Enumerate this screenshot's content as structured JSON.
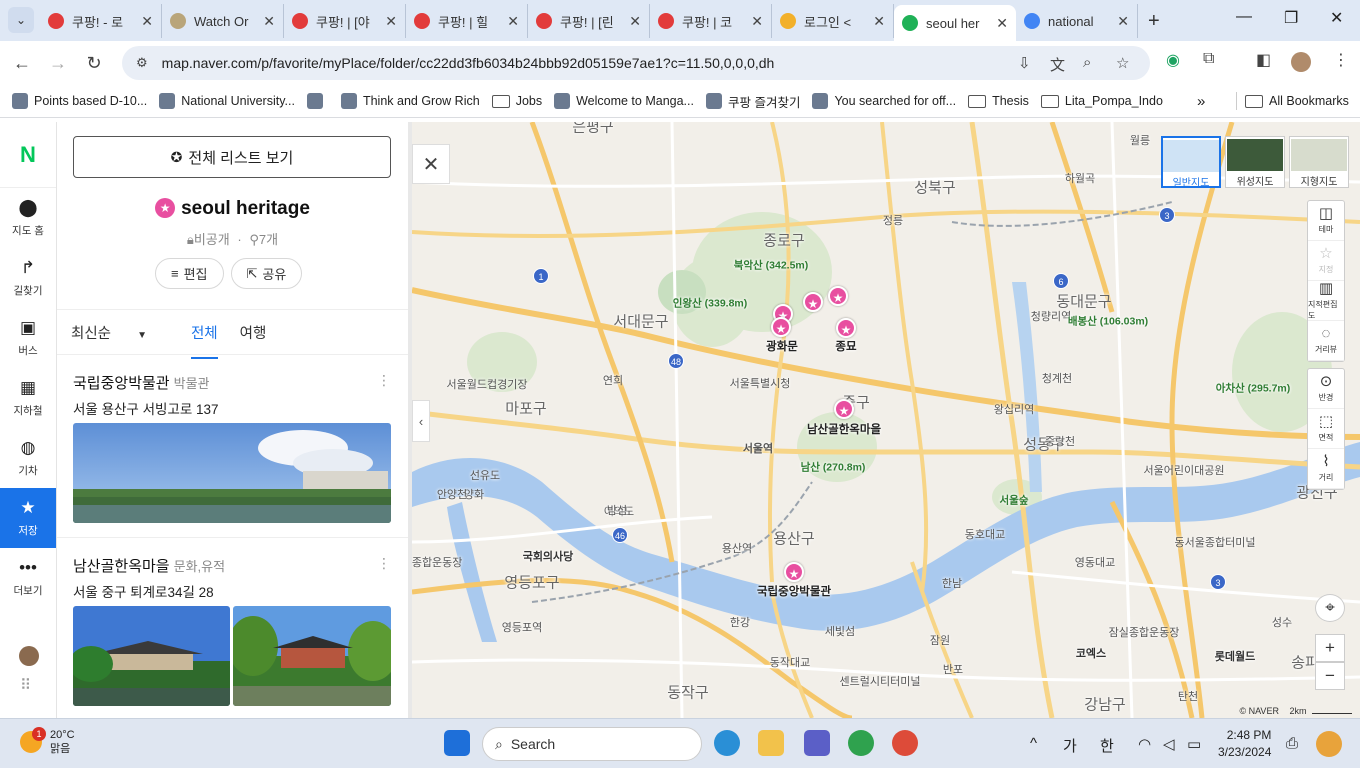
{
  "browser": {
    "tabs": [
      {
        "title": "쿠팡! - 로",
        "icon": "coupang-icon",
        "color": "#e23b3b",
        "active": false
      },
      {
        "title": "Watch Or",
        "icon": "watch-icon",
        "color": "#b9a57a",
        "active": false
      },
      {
        "title": "쿠팡! | [야",
        "icon": "coupang-icon",
        "color": "#e23b3b",
        "active": false
      },
      {
        "title": "쿠팡! | 힐",
        "icon": "coupang-icon",
        "color": "#e23b3b",
        "active": false
      },
      {
        "title": "쿠팡! | [린",
        "icon": "coupang-icon",
        "color": "#e23b3b",
        "active": false
      },
      {
        "title": "쿠팡! | 코",
        "icon": "coupang-icon",
        "color": "#e23b3b",
        "active": false
      },
      {
        "title": "로그인 <",
        "icon": "login-icon",
        "color": "#f2b02a",
        "active": false
      },
      {
        "title": "seoul her",
        "icon": "naver-map-icon",
        "color": "#1fb157",
        "active": true
      },
      {
        "title": "national",
        "icon": "google-icon",
        "color": "#4285f4",
        "active": false
      }
    ],
    "url": "map.naver.com/p/favorite/myPlace/folder/cc22dd3fb6034b24bbb92d05159e7ae1?c=11.50,0,0,0,dh",
    "bookmarks": [
      {
        "label": "Points based D-10...",
        "icon": "green-icon"
      },
      {
        "label": "National University...",
        "icon": "university-icon"
      },
      {
        "label": "",
        "icon": "notion-icon"
      },
      {
        "label": "Think and Grow Rich",
        "icon": "globe-icon"
      },
      {
        "label": "Jobs",
        "icon": "folder-icon"
      },
      {
        "label": "Welcome to Manga...",
        "icon": "manga-icon"
      },
      {
        "label": "쿠팡 즐겨찾기",
        "icon": "coupang-icon"
      },
      {
        "label": "You searched for off...",
        "icon": "g-icon"
      },
      {
        "label": "Thesis",
        "icon": "folder-icon"
      },
      {
        "label": "Lita_Pompa_Indo",
        "icon": "folder-icon"
      }
    ],
    "all_bookmarks": "All Bookmarks",
    "more_bookmarks": "»"
  },
  "leftnav": {
    "logo": "N",
    "items": [
      {
        "label": "지도 홈",
        "icon": "map-pin-icon",
        "glyph": "⬤",
        "active": false
      },
      {
        "label": "길찾기",
        "icon": "directions-icon",
        "glyph": "↱",
        "active": false
      },
      {
        "label": "버스",
        "icon": "bus-icon",
        "glyph": "▣",
        "active": false
      },
      {
        "label": "지하철",
        "icon": "subway-icon",
        "glyph": "▦",
        "active": false
      },
      {
        "label": "기차",
        "icon": "train-icon",
        "glyph": "◍",
        "active": false
      },
      {
        "label": "저장",
        "icon": "star-icon",
        "glyph": "★",
        "active": true
      },
      {
        "label": "더보기",
        "icon": "more-icon",
        "glyph": "•••",
        "active": false
      }
    ]
  },
  "panel": {
    "all_list_button": "전체 리스트 보기",
    "folder_name": "seoul heritage",
    "visibility": "비공개",
    "count": "7개",
    "edit": "편집",
    "share": "공유",
    "sort": "최신순",
    "tabs": [
      "전체",
      "여행"
    ],
    "places": [
      {
        "name": "국립중앙박물관",
        "category": "박물관",
        "address": "서울 용산구 서빙고로 137"
      },
      {
        "name": "남산골한옥마을",
        "category": "문화,유적",
        "address": "서울 중구 퇴계로34길 28"
      }
    ]
  },
  "map": {
    "districts": [
      "은평구",
      "성북구",
      "종로구",
      "서대문구",
      "동대문구",
      "마포구",
      "중구",
      "성동구",
      "광진구",
      "용산구",
      "영등포구",
      "동작구",
      "강남구",
      "송파구"
    ],
    "places": [
      "광화문",
      "종묘",
      "남산골한옥마을",
      "국립중앙박물관",
      "서울역",
      "서울특별시청",
      "국회의사당",
      "코엑스",
      "롯데월드",
      "서울숲",
      "청량리역",
      "북악산 (342.5m)",
      "인왕산 (339.8m)",
      "남산 (270.8m)",
      "배봉산 (106.03m)",
      "아차산 (295.7m)"
    ],
    "small_labels": [
      "정릉",
      "하월곡",
      "월릉",
      "연희",
      "선유도",
      "양화",
      "안양천",
      "여의도",
      "한남",
      "잠원",
      "반포",
      "동작대교",
      "동호대교",
      "영동대교",
      "세빛섬",
      "센트럴시티터미널",
      "청계천",
      "왕십리역",
      "중랑천",
      "서울어린이대공원",
      "동서울종합터미널",
      "잠실종합운동장",
      "탄천",
      "성수",
      "서울월드컵경기장",
      "목동종합운동장",
      "영등포역",
      "용산역",
      "한강",
      "밤섬"
    ],
    "map_types": [
      {
        "label": "일반지도",
        "active": true
      },
      {
        "label": "위성지도",
        "active": false
      },
      {
        "label": "지형지도",
        "active": false
      }
    ],
    "controls_top": [
      {
        "label": "테마",
        "icon": "layers-icon",
        "glyph": "◫"
      },
      {
        "label": "지정",
        "icon": "star-outline-icon",
        "glyph": "☆"
      },
      {
        "label": "지적편집도",
        "icon": "cadastral-icon",
        "glyph": "▥"
      },
      {
        "label": "거리뷰",
        "icon": "street-view-icon",
        "glyph": "◌"
      }
    ],
    "controls_mid": [
      {
        "label": "반경",
        "icon": "radius-icon",
        "glyph": "⊙"
      },
      {
        "label": "면적",
        "icon": "area-icon",
        "glyph": "⬚"
      },
      {
        "label": "거리",
        "icon": "ruler-icon",
        "glyph": "⌇"
      }
    ],
    "scale": "2km",
    "copyright": "© NAVER",
    "road_numbers": [
      "1",
      "3",
      "6",
      "46",
      "48",
      "3"
    ]
  },
  "taskbar": {
    "temp": "20°C",
    "weather": "맑음",
    "notif": "1",
    "search": "Search",
    "ime_ga": "가",
    "ime_han": "한",
    "time": "2:48 PM",
    "date": "3/23/2024"
  }
}
